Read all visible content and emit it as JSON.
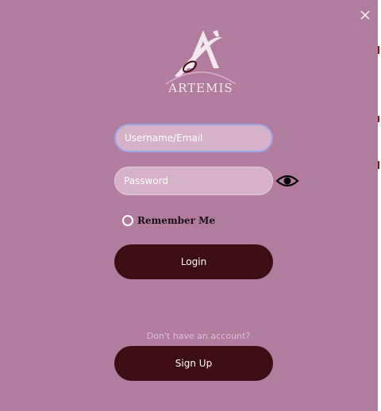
{
  "app": {
    "logo_text": "ARTEMIS"
  },
  "icons": {
    "close": "close-icon",
    "logo": "artemis-logo-icon",
    "password_toggle": "eye-icon",
    "remember": "radio-icon"
  },
  "form": {
    "username_placeholder": "Username/Email",
    "password_placeholder": "Password",
    "remember_label": "Remember Me",
    "login_label": "Login"
  },
  "signup": {
    "prompt": "Don't have an account?",
    "button_label": "Sign Up"
  },
  "colors": {
    "background": "#b27c9f",
    "input_fill": "#d6b2ca",
    "focus_border": "#9aa3ea",
    "button": "#3e0c13",
    "text_light": "#ffffff",
    "prompt_text": "#d9c1d1"
  }
}
